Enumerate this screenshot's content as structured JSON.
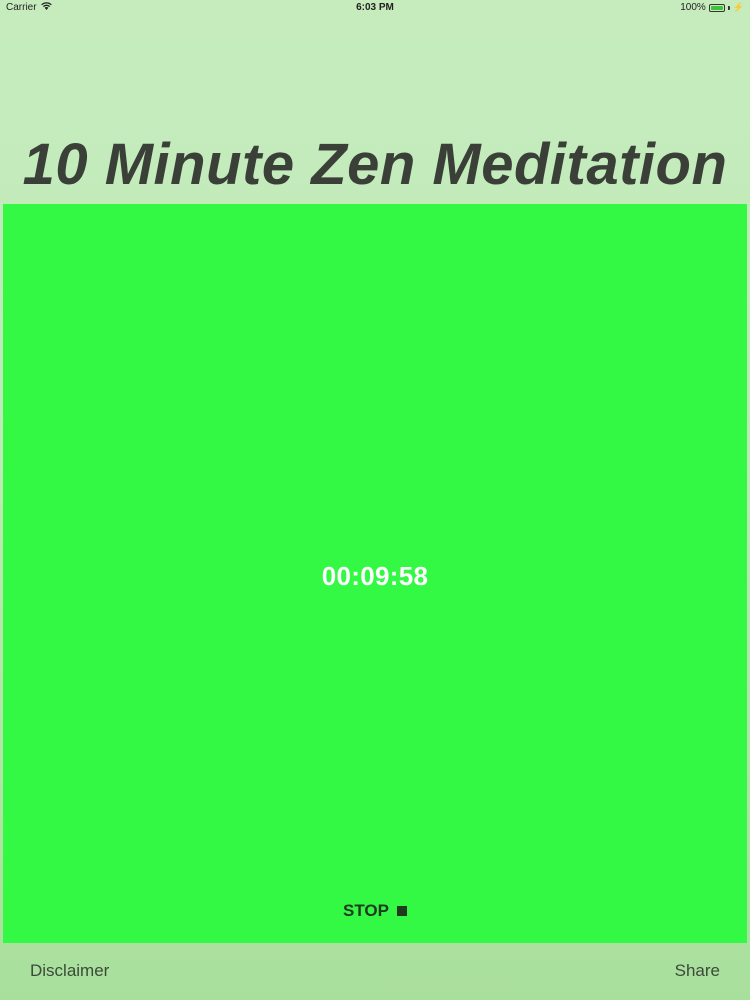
{
  "status_bar": {
    "carrier": "Carrier",
    "time": "6:03 PM",
    "battery_percent": "100%",
    "battery_level": 1.0,
    "icons": [
      "wifi-icon",
      "battery-icon",
      "charging-bolt-icon"
    ]
  },
  "title": "10 Minute Zen Meditation",
  "timer": {
    "display": "00:09:58"
  },
  "stop": {
    "label": "STOP",
    "icon": "stop-square-icon"
  },
  "footer": {
    "disclaimer_label": "Disclaimer",
    "share_label": "Share"
  },
  "colors": {
    "background_top": "#c6ecbe",
    "background_bottom": "#a9df9c",
    "panel": "#33f944",
    "title": "#3a3f38",
    "timer_text": "#ffffff",
    "stop_text": "#203a20"
  }
}
